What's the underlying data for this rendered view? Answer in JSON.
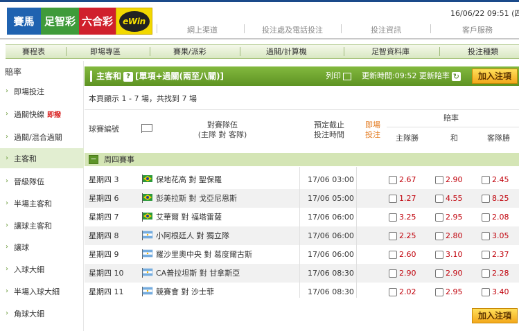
{
  "header": {
    "tabs": [
      "賽馬",
      "足智彩",
      "六合彩"
    ],
    "logo_text": "eWin",
    "datetime": "16/06/22 09:51 (四",
    "links": [
      "網上渠道",
      "投注處及電話投注",
      "投注資訊",
      "客戶服務"
    ]
  },
  "mainnav": [
    "賽程表",
    "即場專區",
    "賽果/派彩",
    "過關/計算機",
    "足智資料庫",
    "投注種類"
  ],
  "sidebar": {
    "title": "賠率",
    "items": [
      {
        "label": "即場投注",
        "badge": ""
      },
      {
        "label": "過關快線",
        "badge": "即撥"
      },
      {
        "label": "過關/混合過關",
        "badge": ""
      },
      {
        "label": "主客和",
        "badge": ""
      },
      {
        "label": "晉級隊伍",
        "badge": ""
      },
      {
        "label": "半場主客和",
        "badge": ""
      },
      {
        "label": "讓球主客和",
        "badge": ""
      },
      {
        "label": "讓球",
        "badge": ""
      },
      {
        "label": "入球大細",
        "badge": ""
      },
      {
        "label": "半場入球大細",
        "badge": ""
      },
      {
        "label": "角球大細",
        "badge": ""
      }
    ]
  },
  "content": {
    "title": "主客和",
    "subtitle": "[單項+過關(兩至八關)]",
    "print_label": "列印",
    "update_text": "更新時間:09:52 更新賠率",
    "add_button": "加入注項",
    "show_info": "本頁顯示 1 - 7 場，共找到 7 場",
    "columns": {
      "match_no": "球賽編號",
      "teams_line1": "對賽隊伍",
      "teams_line2": "(主隊 對 客隊)",
      "time_line1": "預定截止",
      "time_line2": "投注時間",
      "live_line1": "即場",
      "live_line2": "投注",
      "odds": "賠率",
      "home": "主隊勝",
      "draw": "和",
      "away": "客隊勝"
    },
    "group": "周四賽事",
    "matches": [
      {
        "no": "星期四 3",
        "teams": "保地花高 對 聖保羅",
        "time": "17/06 03:00",
        "flag": "brazil",
        "home": "2.67",
        "draw": "2.90",
        "away": "2.45"
      },
      {
        "no": "星期四 6",
        "teams": "彭美拉斯 對 戈亞尼恩斯",
        "time": "17/06 05:00",
        "flag": "brazil",
        "home": "1.27",
        "draw": "4.55",
        "away": "8.25"
      },
      {
        "no": "星期四 7",
        "teams": "艾華爾 對 福塔雷薩",
        "time": "17/06 06:00",
        "flag": "brazil",
        "home": "3.25",
        "draw": "2.95",
        "away": "2.08"
      },
      {
        "no": "星期四 8",
        "teams": "小阿根廷人 對 獨立隊",
        "time": "17/06 06:00",
        "flag": "argentina",
        "home": "2.25",
        "draw": "2.80",
        "away": "3.05"
      },
      {
        "no": "星期四 9",
        "teams": "羅沙里奧中央 對 葛度爾古斯",
        "time": "17/06 06:00",
        "flag": "argentina",
        "home": "2.60",
        "draw": "3.10",
        "away": "2.37"
      },
      {
        "no": "星期四 10",
        "teams": "CA普拉坦斯 對 甘拿斯亞",
        "time": "17/06 08:30",
        "flag": "argentina",
        "home": "2.90",
        "draw": "2.90",
        "away": "2.28"
      },
      {
        "no": "星期四 11",
        "teams": "競賽會 對 沙士菲",
        "time": "17/06 08:30",
        "flag": "argentina",
        "home": "2.02",
        "draw": "2.95",
        "away": "3.40"
      }
    ]
  },
  "colors": {
    "horse_tab": "#1f62b0",
    "football_tab": "#3f9b3a",
    "mark6_tab": "#d0202c",
    "title_bar": "#6fa431",
    "odds_text": "#c0000a",
    "add_button": "#f8c53a"
  }
}
